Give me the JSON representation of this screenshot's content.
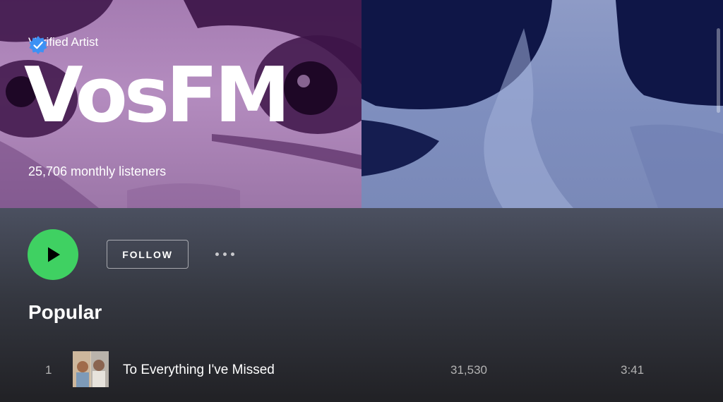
{
  "artist": {
    "verified_label": "Verified Artist",
    "name": "VosFM",
    "monthly_listeners": "25,706 monthly listeners"
  },
  "actions": {
    "follow_label": "FOLLOW"
  },
  "popular": {
    "title": "Popular",
    "tracks": [
      {
        "number": "1",
        "title": "To Everything I've Missed",
        "plays": "31,530",
        "duration": "3:41"
      }
    ]
  },
  "colors": {
    "play_button": "#3fd162",
    "verified_badge": "#3d91f4",
    "hero_left": "#b48cbf",
    "hero_right": "#8e9bc6"
  },
  "icons": {
    "verified": "verified-badge-icon",
    "play": "play-icon",
    "more": "more-options-icon"
  }
}
